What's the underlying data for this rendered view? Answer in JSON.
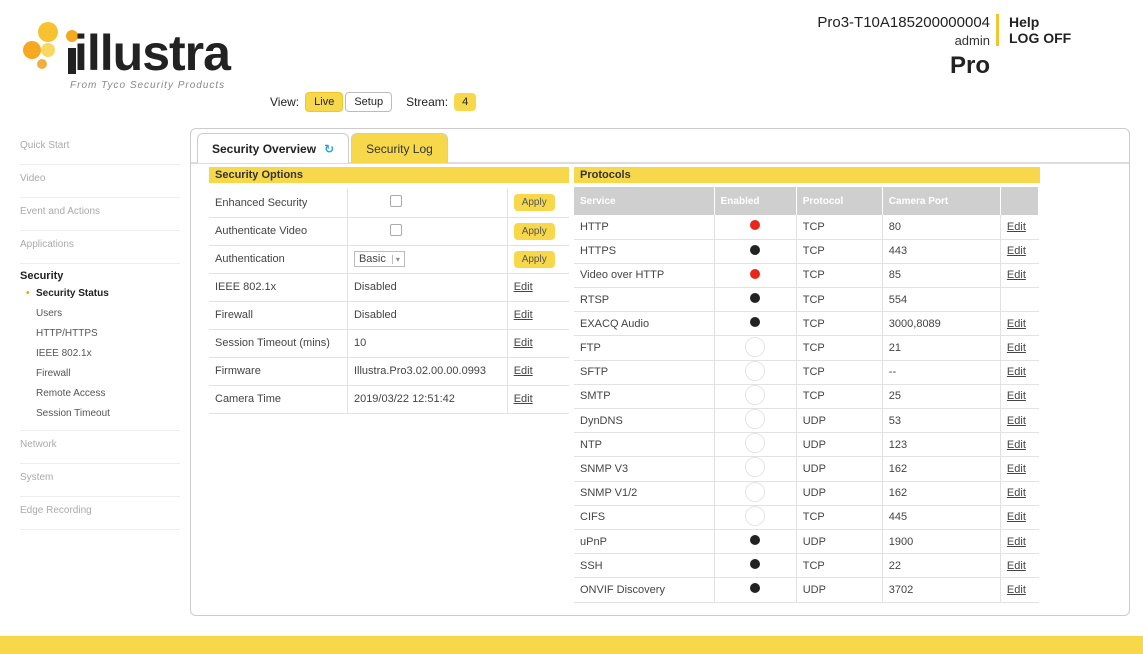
{
  "brand": {
    "name": "illustra",
    "tagline": "From Tyco Security Products"
  },
  "view": {
    "label": "View:",
    "live": "Live",
    "setup": "Setup",
    "stream_label": "Stream:",
    "stream_value": "4"
  },
  "device": {
    "id": "Pro3-T10A185200000004",
    "user": "admin",
    "model": "Pro"
  },
  "header": {
    "help": "Help",
    "logoff": "LOG OFF"
  },
  "nav": {
    "top": [
      "Quick Start",
      "Video",
      "Event and Actions",
      "Applications"
    ],
    "section": "Security",
    "sub": [
      "Security Status",
      "Users",
      "HTTP/HTTPS",
      "IEEE 802.1x",
      "Firewall",
      "Remote Access",
      "Session Timeout"
    ],
    "bottom": [
      "Network",
      "System",
      "Edge Recording"
    ]
  },
  "tabs": {
    "overview": "Security Overview",
    "log": "Security Log"
  },
  "security_options": {
    "title": "Security Options",
    "apply": "Apply",
    "edit": "Edit",
    "rows": [
      {
        "label": "Enhanced Security",
        "type": "checkbox"
      },
      {
        "label": "Authenticate Video",
        "type": "checkbox"
      },
      {
        "label": "Authentication",
        "type": "select",
        "value": "Basic"
      },
      {
        "label": "IEEE 802.1x",
        "type": "text",
        "value": "Disabled"
      },
      {
        "label": "Firewall",
        "type": "text",
        "value": "Disabled"
      },
      {
        "label": "Session Timeout (mins)",
        "type": "text",
        "value": "10"
      },
      {
        "label": "Firmware",
        "type": "text",
        "value": "Illustra.Pro3.02.00.00.0993"
      },
      {
        "label": "Camera Time",
        "type": "text",
        "value": "2019/03/22 12:51:42"
      }
    ]
  },
  "protocols": {
    "title": "Protocols",
    "columns": [
      "Service",
      "Enabled",
      "Protocol",
      "Camera Port",
      ""
    ],
    "edit": "Edit",
    "colors": {
      "red": "#e8261c",
      "black": "#222222"
    },
    "rows": [
      {
        "service": "HTTP",
        "enabled": "red",
        "protocol": "TCP",
        "port": "80",
        "edit": true
      },
      {
        "service": "HTTPS",
        "enabled": "black",
        "protocol": "TCP",
        "port": "443",
        "edit": true
      },
      {
        "service": "Video over HTTP",
        "enabled": "red",
        "protocol": "TCP",
        "port": "85",
        "edit": true
      },
      {
        "service": "RTSP",
        "enabled": "black",
        "protocol": "TCP",
        "port": "554",
        "edit": false
      },
      {
        "service": "EXACQ Audio",
        "enabled": "black",
        "protocol": "TCP",
        "port": "3000,8089",
        "edit": true
      },
      {
        "service": "FTP",
        "enabled": "empty",
        "protocol": "TCP",
        "port": "21",
        "edit": true
      },
      {
        "service": "SFTP",
        "enabled": "empty",
        "protocol": "TCP",
        "port": "--",
        "edit": true
      },
      {
        "service": "SMTP",
        "enabled": "empty",
        "protocol": "TCP",
        "port": "25",
        "edit": true
      },
      {
        "service": "DynDNS",
        "enabled": "empty",
        "protocol": "UDP",
        "port": "53",
        "edit": true
      },
      {
        "service": "NTP",
        "enabled": "empty",
        "protocol": "UDP",
        "port": "123",
        "edit": true
      },
      {
        "service": "SNMP V3",
        "enabled": "empty",
        "protocol": "UDP",
        "port": "162",
        "edit": true
      },
      {
        "service": "SNMP V1/2",
        "enabled": "empty",
        "protocol": "UDP",
        "port": "162",
        "edit": true
      },
      {
        "service": "CIFS",
        "enabled": "empty",
        "protocol": "TCP",
        "port": "445",
        "edit": true
      },
      {
        "service": "uPnP",
        "enabled": "black",
        "protocol": "UDP",
        "port": "1900",
        "edit": true
      },
      {
        "service": "SSH",
        "enabled": "black",
        "protocol": "TCP",
        "port": "22",
        "edit": true
      },
      {
        "service": "ONVIF Discovery",
        "enabled": "black",
        "protocol": "UDP",
        "port": "3702",
        "edit": true
      }
    ]
  }
}
